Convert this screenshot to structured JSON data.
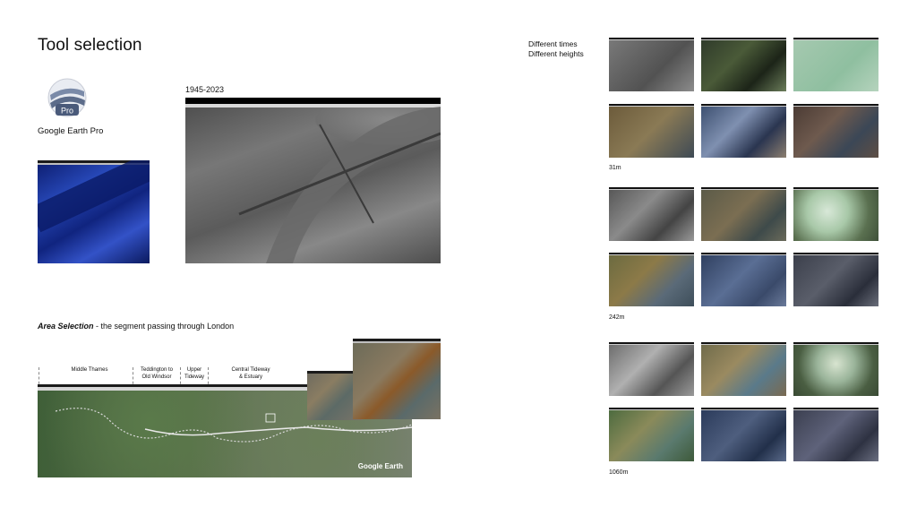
{
  "title": "Tool selection",
  "logo": {
    "badge": "Pro",
    "label": "Google Earth Pro"
  },
  "historic": {
    "year_range": "1945-2023"
  },
  "side_note": {
    "line1": "Different times",
    "line2": "Different heights"
  },
  "area": {
    "label_bold": "Area Selection",
    "label_rest": " - the segment passing through London",
    "segments": [
      {
        "line1": "Middle Thames",
        "line2": ""
      },
      {
        "line1": "Teddington to",
        "line2": "Old Windsor"
      },
      {
        "line1": "Upper",
        "line2": "Tideway"
      },
      {
        "line1": "Central Tideway",
        "line2": "& Estuary"
      }
    ],
    "watermark": "Google Earth"
  },
  "heights": [
    {
      "label": "31m"
    },
    {
      "label": "242m"
    },
    {
      "label": "1060m"
    }
  ]
}
